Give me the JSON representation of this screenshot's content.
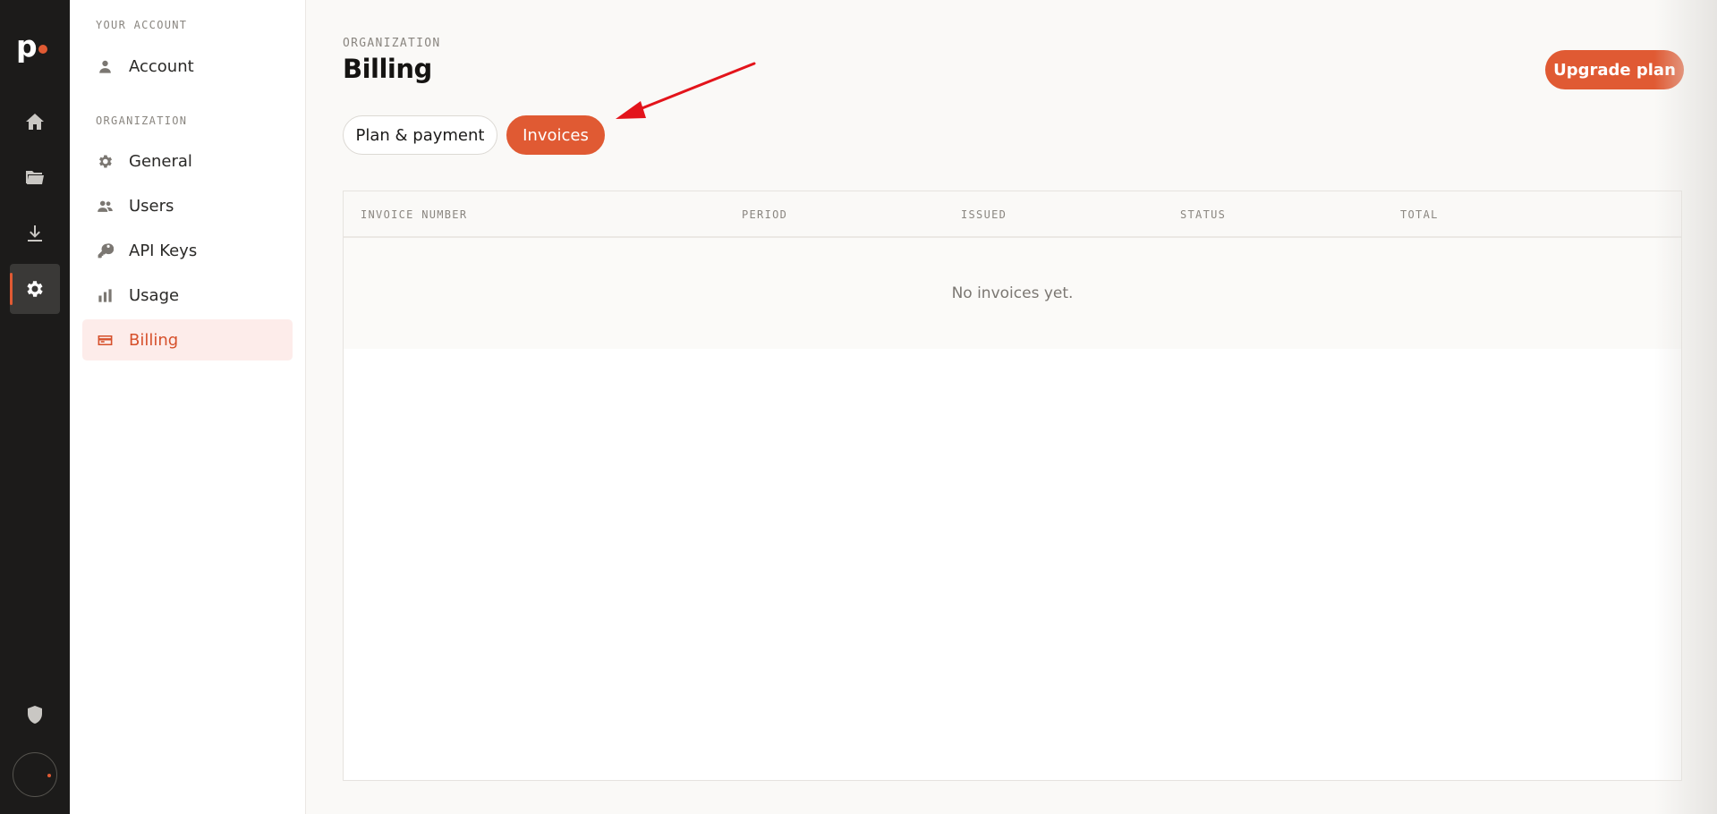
{
  "rail": {
    "logo_text": "p",
    "items": [
      {
        "icon": "home-icon"
      },
      {
        "icon": "folder-icon"
      },
      {
        "icon": "download-icon"
      },
      {
        "icon": "gear-icon",
        "active": true
      }
    ],
    "bottom": {
      "icon": "shield-icon"
    }
  },
  "nav": {
    "account_section": "YOUR ACCOUNT",
    "account_label": "Account",
    "org_section": "ORGANIZATION",
    "items": [
      {
        "label": "General"
      },
      {
        "label": "Users"
      },
      {
        "label": "API Keys"
      },
      {
        "label": "Usage"
      },
      {
        "label": "Billing"
      }
    ]
  },
  "main": {
    "eyebrow": "ORGANIZATION",
    "title": "Billing",
    "upgrade_label": "Upgrade plan",
    "tabs": [
      {
        "label": "Plan & payment"
      },
      {
        "label": "Invoices",
        "active": true
      }
    ],
    "table": {
      "columns": [
        "INVOICE NUMBER",
        "PERIOD",
        "ISSUED",
        "STATUS",
        "TOTAL"
      ],
      "empty_text": "No invoices yet."
    }
  },
  "colors": {
    "accent": "#e05a33",
    "rail_bg": "#1c1b1a",
    "nav_active_bg": "#fdecea",
    "annotation_arrow": "#e3141b"
  }
}
